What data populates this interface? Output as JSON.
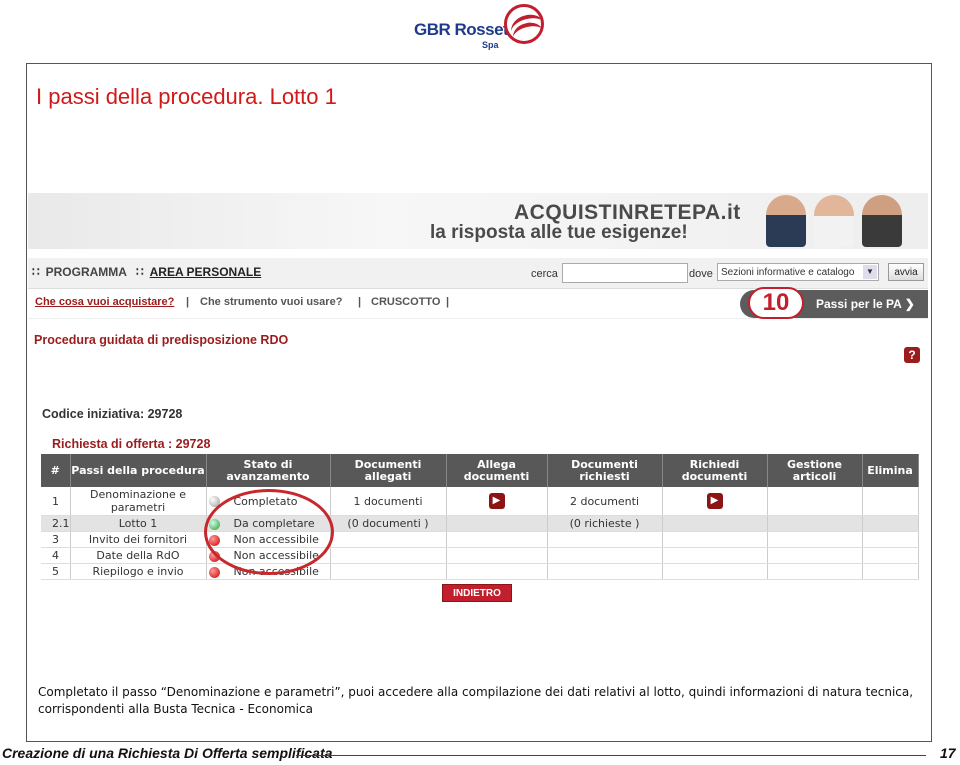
{
  "logo": {
    "brand": "GBR",
    "name": "Rossetto",
    "suffix": "Spa"
  },
  "slide": {
    "title": "I passi della procedura. Lotto 1",
    "caption": "Completato il passo “Denominazione e parametri”, puoi accedere alla compilazione dei dati relativi al lotto, quindi informazioni di natura tecnica, corrispondenti alla Busta Tecnica - Economica"
  },
  "banner": {
    "line1": "ACQUISTINRETEPA.it",
    "line2": "la risposta alle tue esigenze!"
  },
  "nav": {
    "programma": "PROGRAMMA",
    "area_personale": "AREA PERSONALE",
    "cerca_label": "cerca",
    "cerca_value": "",
    "dove_label": "dove",
    "dove_value": "Sezioni informative e catalogo",
    "avvia": "avvia"
  },
  "menu": {
    "item1": "Che cosa vuoi acquistare?",
    "item2": "Che strumento vuoi usare?",
    "item3": "CRUSCOTTO",
    "sep": "|",
    "passi_num": "10",
    "passi_label": "Passi per le PA"
  },
  "procedure": {
    "title": "Procedura guidata di predisposizione RDO",
    "help": "?",
    "codice_label": "Codice iniziativa:",
    "codice_value": "29728",
    "richiesta": "Richiesta di offerta : 29728"
  },
  "table": {
    "headers": [
      "#",
      "Passi della procedura",
      "Stato di avanzamento",
      "Documenti allegati",
      "Allega documenti",
      "Documenti richiesti",
      "Richiedi documenti",
      "Gestione articoli",
      "Elimina"
    ],
    "rows": [
      {
        "num": "1",
        "step": "Denominazione e parametri",
        "status": "Completato",
        "dot": "grey",
        "allegati": "1 documenti",
        "richiesti": "2 documenti"
      },
      {
        "num": "2.1",
        "step": "Lotto 1",
        "status": "Da completare",
        "dot": "green",
        "allegati": "(0 documenti )",
        "richiesti": "(0 richieste )"
      },
      {
        "num": "3",
        "step": "Invito dei fornitori",
        "status": "Non accessibile",
        "dot": "red",
        "allegati": "",
        "richiesti": ""
      },
      {
        "num": "4",
        "step": "Date della RdO",
        "status": "Non accessibile",
        "dot": "red",
        "allegati": "",
        "richiesti": ""
      },
      {
        "num": "5",
        "step": "Riepilogo e invio",
        "status": "Non accessibile",
        "dot": "red",
        "allegati": "",
        "richiesti": ""
      }
    ]
  },
  "buttons": {
    "indietro": "INDIETRO"
  },
  "footer": {
    "title": "Creazione di una Richiesta Di Offerta semplificata",
    "page": "17"
  },
  "colors": {
    "accent_red": "#d01919",
    "brand_red": "#9b1c1c",
    "header_grey": "#585858"
  }
}
